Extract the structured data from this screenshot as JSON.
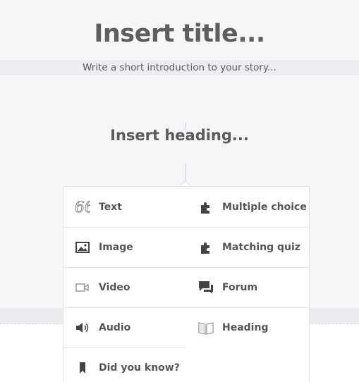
{
  "editor": {
    "title_placeholder": "Insert title...",
    "intro_placeholder": "Write a short introduction to your story...",
    "heading_placeholder": "Insert heading..."
  },
  "insert_menu": {
    "items": [
      {
        "label": "Text",
        "icon": "quote-icon"
      },
      {
        "label": "Multiple choice",
        "icon": "puzzle-icon"
      },
      {
        "label": "Image",
        "icon": "image-icon"
      },
      {
        "label": "Matching quiz",
        "icon": "puzzle-icon"
      },
      {
        "label": "Video",
        "icon": "video-camera-icon"
      },
      {
        "label": "Forum",
        "icon": "chat-bubbles-icon"
      },
      {
        "label": "Audio",
        "icon": "speaker-icon"
      },
      {
        "label": "Heading",
        "icon": "book-icon"
      },
      {
        "label": "Did you know?",
        "icon": "bookmark-icon"
      }
    ]
  },
  "colors": {
    "background": "#f4f6f8",
    "menu_background": "#ffffff",
    "text": "#555555",
    "cursor": "#a9d4ea"
  }
}
